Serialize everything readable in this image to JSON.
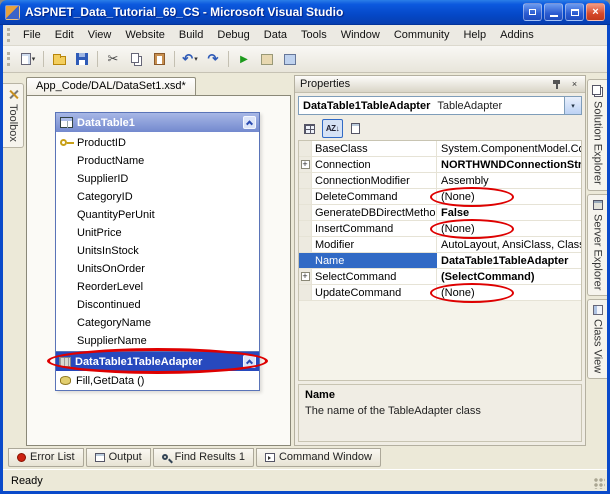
{
  "titlebar": {
    "title": "ASPNET_Data_Tutorial_69_CS - Microsoft Visual Studio"
  },
  "icons": {
    "close": "×",
    "dropdown": "▾",
    "cut": "✂",
    "undo": "↶",
    "redo": "↷",
    "run": "▶",
    "sort_az": "AZ↓"
  },
  "menu": {
    "items": [
      "File",
      "Edit",
      "View",
      "Website",
      "Build",
      "Debug",
      "Data",
      "Tools",
      "Window",
      "Community",
      "Help",
      "Addins"
    ]
  },
  "doc": {
    "tab_label": "App_Code/DAL/DataSet1.xsd*"
  },
  "toolbox": {
    "label": "Toolbox"
  },
  "designer": {
    "table_title": "DataTable1",
    "fields": [
      "ProductID",
      "ProductName",
      "SupplierID",
      "CategoryID",
      "QuantityPerUnit",
      "UnitPrice",
      "UnitsInStock",
      "UnitsOnOrder",
      "ReorderLevel",
      "Discontinued",
      "CategoryName",
      "SupplierName"
    ],
    "adapter_name": "DataTable1TableAdapter",
    "adapter_methods": "Fill,GetData ()"
  },
  "properties": {
    "panel_title": "Properties",
    "object_name": "DataTable1TableAdapter",
    "object_type": "TableAdapter",
    "rows": [
      {
        "expand": "",
        "label": "BaseClass",
        "value": "System.ComponentModel.Con"
      },
      {
        "expand": "+",
        "label": "Connection",
        "value": "NORTHWNDConnectionStr"
      },
      {
        "expand": "",
        "label": "ConnectionModifier",
        "value": "Assembly"
      },
      {
        "expand": "",
        "label": "DeleteCommand",
        "value": "(None)"
      },
      {
        "expand": "",
        "label": "GenerateDBDirectMethod",
        "value": "False"
      },
      {
        "expand": "",
        "label": "InsertCommand",
        "value": "(None)"
      },
      {
        "expand": "",
        "label": "Modifier",
        "value": "AutoLayout, AnsiClass, Class,"
      },
      {
        "expand": "",
        "label": "Name",
        "value": "DataTable1TableAdapter"
      },
      {
        "expand": "+",
        "label": "SelectCommand",
        "value": "(SelectCommand)"
      },
      {
        "expand": "",
        "label": "UpdateCommand",
        "value": "(None)"
      }
    ],
    "description_title": "Name",
    "description_text": "The name of the TableAdapter class"
  },
  "right_tabs": {
    "items": [
      "Solution Explorer",
      "Server Explorer",
      "Class View"
    ]
  },
  "bottom_tabs": {
    "items": [
      "Error List",
      "Output",
      "Find Results 1",
      "Command Window"
    ]
  },
  "statusbar": {
    "text": "Ready"
  },
  "colors": {
    "selection_blue": "#316AC5",
    "adapter_blue": "#2749BE",
    "annotation_red": "#DE0000",
    "titlebar_blue": "#0548C8"
  }
}
